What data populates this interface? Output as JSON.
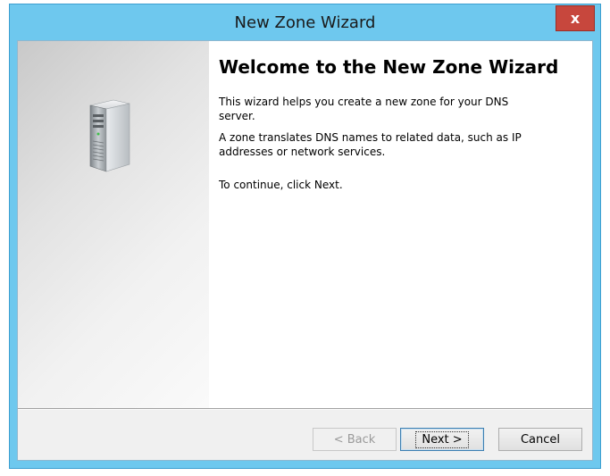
{
  "window": {
    "title": "New Zone Wizard",
    "close_label": "x"
  },
  "left_panel": {
    "icon": "server-icon"
  },
  "content": {
    "heading": "Welcome to the New Zone Wizard",
    "paragraphs": [
      "This wizard helps you create a new zone for your DNS server.",
      "A zone translates DNS names to related data, such as IP addresses or network services.",
      "To continue, click Next."
    ]
  },
  "buttons": {
    "back": {
      "label": "< Back",
      "enabled": false
    },
    "next": {
      "label": "Next >",
      "enabled": true,
      "default": true
    },
    "cancel": {
      "label": "Cancel",
      "enabled": true
    }
  },
  "colors": {
    "frame": "#6ec8ee",
    "close_button": "#c7473d",
    "button_bar": "#f0f0f0"
  }
}
